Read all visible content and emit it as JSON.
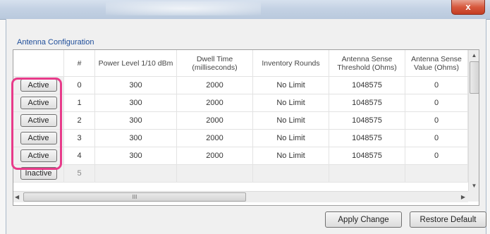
{
  "window": {
    "close_glyph": "x"
  },
  "group": {
    "label": "Antenna Configuration"
  },
  "table": {
    "headers": [
      "",
      "#",
      "Power Level 1/10 dBm",
      "Dwell Time (milliseconds)",
      "Inventory Rounds",
      "Antenna Sense Threshold (Ohms)",
      "Antenna Sense Value (Ohms)"
    ],
    "rows": [
      {
        "state": "Active",
        "num": "0",
        "power": "300",
        "dwell": "2000",
        "rounds": "No Limit",
        "threshold": "1048575",
        "value": "0"
      },
      {
        "state": "Active",
        "num": "1",
        "power": "300",
        "dwell": "2000",
        "rounds": "No Limit",
        "threshold": "1048575",
        "value": "0"
      },
      {
        "state": "Active",
        "num": "2",
        "power": "300",
        "dwell": "2000",
        "rounds": "No Limit",
        "threshold": "1048575",
        "value": "0"
      },
      {
        "state": "Active",
        "num": "3",
        "power": "300",
        "dwell": "2000",
        "rounds": "No Limit",
        "threshold": "1048575",
        "value": "0"
      },
      {
        "state": "Active",
        "num": "4",
        "power": "300",
        "dwell": "2000",
        "rounds": "No Limit",
        "threshold": "1048575",
        "value": "0"
      },
      {
        "state": "Inactive",
        "num": "5",
        "power": "",
        "dwell": "",
        "rounds": "",
        "threshold": "",
        "value": ""
      }
    ]
  },
  "scrollbar": {
    "h_thumb_grip": "III"
  },
  "buttons": {
    "apply": "Apply Change",
    "restore": "Restore Default"
  },
  "colors": {
    "highlight": "#e83b8a",
    "group_label": "#1f4e9a",
    "close": "#c33d23"
  },
  "icons": [
    "close-icon",
    "scroll-up-icon",
    "scroll-down-icon",
    "scroll-left-icon",
    "scroll-right-icon"
  ]
}
